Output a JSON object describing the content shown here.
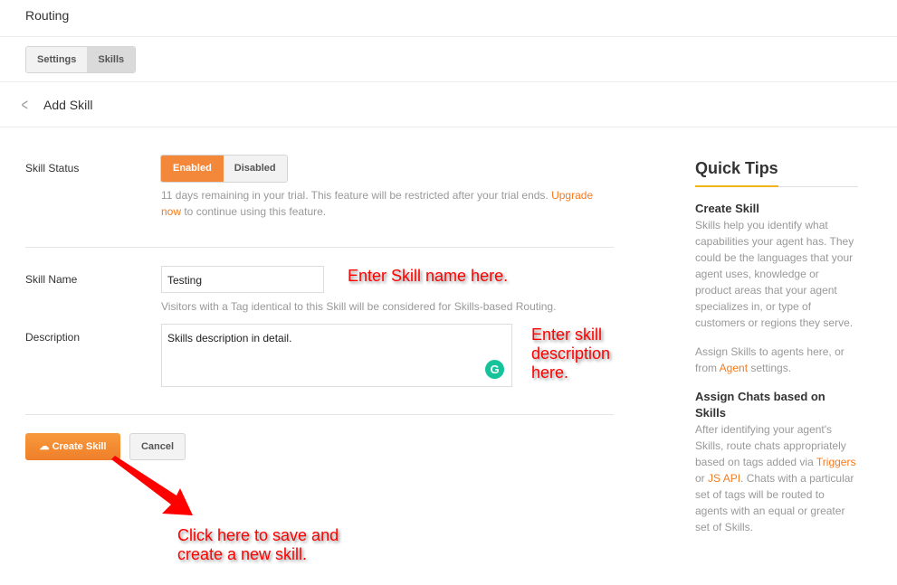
{
  "header": {
    "title": "Routing"
  },
  "tabs": [
    {
      "label": "Settings",
      "active": false
    },
    {
      "label": "Skills",
      "active": true
    }
  ],
  "subheader": {
    "title": "Add Skill"
  },
  "form": {
    "status": {
      "label": "Skill Status",
      "options": [
        "Enabled",
        "Disabled"
      ],
      "selected": "Enabled",
      "trial_text": "11 days remaining in your trial. This feature will be restricted after your trial ends. ",
      "upgrade_link": "Upgrade now",
      "trial_suffix": " to continue using this feature."
    },
    "name": {
      "label": "Skill Name",
      "value": "Testing",
      "help": "Visitors with a Tag identical to this Skill will be considered for Skills-based Routing."
    },
    "description": {
      "label": "Description",
      "value": "Skills description in detail."
    },
    "create_label": "Create Skill",
    "cancel_label": "Cancel"
  },
  "annotations": {
    "name": "Enter Skill name here.",
    "description": "Enter skill description here.",
    "create": "Click here to save and create a new skill."
  },
  "tips": {
    "title": "Quick Tips",
    "s1_title": "Create Skill",
    "s1_p1": "Skills help you identify what capabilities your agent has. They could be the languages that your agent uses, knowledge or product areas that your agent specializes in, or type of customers or regions they serve.",
    "s1_p2a": "Assign Skills to agents here, or from ",
    "s1_p2_link": "Agent",
    "s1_p2b": " settings.",
    "s2_title": "Assign Chats based on Skills",
    "s2_a": "After identifying your agent's Skills, route chats appropriately based on tags added via ",
    "s2_link1": "Triggers",
    "s2_b": " or ",
    "s2_link2": "JS API",
    "s2_c": ". Chats with a particular set of tags will be routed to agents with an equal or greater set of Skills."
  },
  "colors": {
    "accent": "#f4883a",
    "link": "#f47b20",
    "tips_underline": "#f2b31c",
    "annotation": "#ff0000"
  }
}
